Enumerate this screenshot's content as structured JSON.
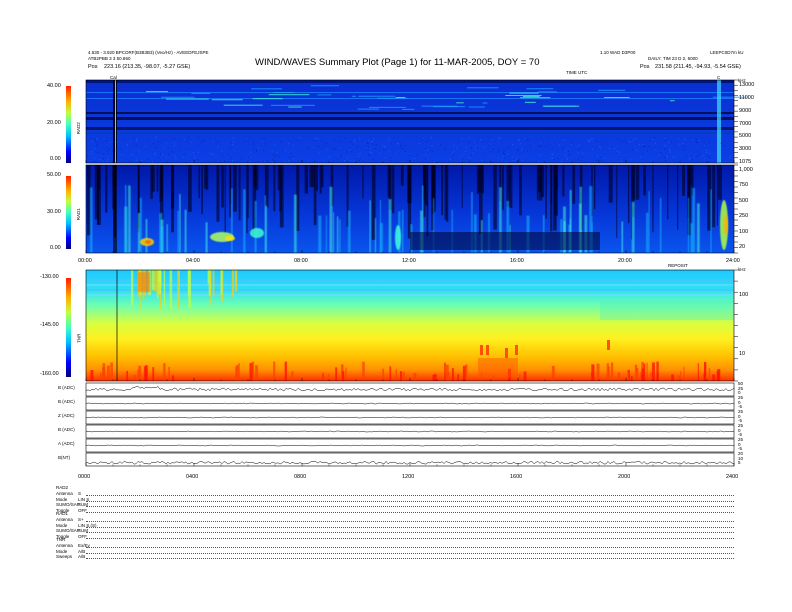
{
  "header": {
    "title": "WIND/WAVES Summary Plot (Page 1) for 11-MAR-2005, DOY = 70",
    "left_line1": "4.530 - 3.920 BPCORF(B3B3B3) (Veo/Hz) - AVEEDFEJSPE",
    "left_line2": "ATB2PBB 3 3 50.860",
    "left_pos_label": "Pos",
    "left_pos": "223.16 (213.35, -98.07, -5.27 GSE)",
    "right_line1": "1.10 WAD D3P00",
    "right_line2": "DAILY: TIM 23 D 2, 5000",
    "right_line3": "LEEPC0D7m kU",
    "right_pos_label": "Pos",
    "right_pos": "231.58 (211.45, -94.93, -5.54 GSE)",
    "time_unit_label": "TIME UTC",
    "cal_label": "Cal",
    "c_label": "C"
  },
  "chart_data": [
    {
      "type": "heatmap",
      "name": "RAD2",
      "title": "",
      "ylabel": "RAD2",
      "yunit": "kHz",
      "colorbar_ticks": [
        "40.00",
        "20.00",
        "0.00"
      ],
      "colorbar_range": [
        0,
        40
      ],
      "yticks": [
        "13000",
        "11000",
        "9000",
        "7000",
        "5000",
        "3000",
        "1075"
      ],
      "y_range": [
        1075,
        13825
      ]
    },
    {
      "type": "heatmap",
      "name": "RAD1",
      "title": "",
      "ylabel": "RAD1",
      "yunit": "kHz",
      "colorbar_ticks": [
        "50.00",
        "30.00",
        "0.00"
      ],
      "colorbar_range": [
        0,
        50
      ],
      "yticks": [
        "1,000",
        "750",
        "500",
        "250",
        "100",
        "20"
      ],
      "y_range": [
        20,
        1040
      ]
    },
    {
      "type": "heatmap",
      "name": "TNR",
      "title": "",
      "ylabel": "TNR",
      "yunit": "kHz",
      "colorbar_ticks": [
        "-130.00",
        "-145.00",
        "-160.00"
      ],
      "colorbar_range": [
        -160,
        -130
      ],
      "yticks": [
        "100",
        "10"
      ],
      "y_range": [
        4,
        256
      ]
    },
    {
      "type": "line",
      "name": "magnetometer_panels",
      "panels": [
        {
          "label": "B (ADC)",
          "ticks": [
            "50",
            "25",
            "0"
          ]
        },
        {
          "label": "B (ADC)",
          "ticks": [
            "25",
            "0",
            "-5"
          ]
        },
        {
          "label": "Z (ADC)",
          "ticks": [
            "25",
            "0",
            "-5"
          ]
        },
        {
          "label": "B (ADC)",
          "ticks": [
            "25",
            "0",
            "-5"
          ]
        },
        {
          "label": "A (ADC)",
          "ticks": [
            "25",
            "0",
            "-5"
          ]
        },
        {
          "label": "B(NT)",
          "ticks": [
            "20",
            "10",
            "5"
          ]
        }
      ]
    }
  ],
  "time_axis": {
    "ticks_top": [
      "00:00",
      "04:00",
      "08:00",
      "12:00",
      "16:00",
      "20:00",
      "24:00"
    ],
    "ticks_bottom": [
      "0000",
      "0400",
      "0800",
      "1200",
      "1600",
      "2000",
      "2400"
    ],
    "ticks_mid_right": "REPOSIT"
  },
  "footer": {
    "rad2_title": "RAD2",
    "rad2_rows": [
      {
        "label": "Antenna",
        "value": "S"
      },
      {
        "label": "Mode",
        "value": "LIN S"
      },
      {
        "label": "SUMO/SAP",
        "value": "SUM"
      },
      {
        "label": "Toggle",
        "value": "OFF"
      }
    ],
    "rad1_title": "RAD1",
    "rad1_rows": [
      {
        "label": "Antenna",
        "value": "S+"
      },
      {
        "label": "Mode",
        "value": "LIN S,(S)"
      },
      {
        "label": "SUMO/SAP",
        "value": "SUM"
      },
      {
        "label": "Toggle",
        "value": "OFF"
      }
    ],
    "tnr_title": "TNR",
    "tnr_rows": [
      {
        "label": "Antenna",
        "value": "Ex/Ey"
      },
      {
        "label": "Mode",
        "value": "A/B"
      },
      {
        "label": "Sweeps",
        "value": "A/B"
      }
    ]
  }
}
